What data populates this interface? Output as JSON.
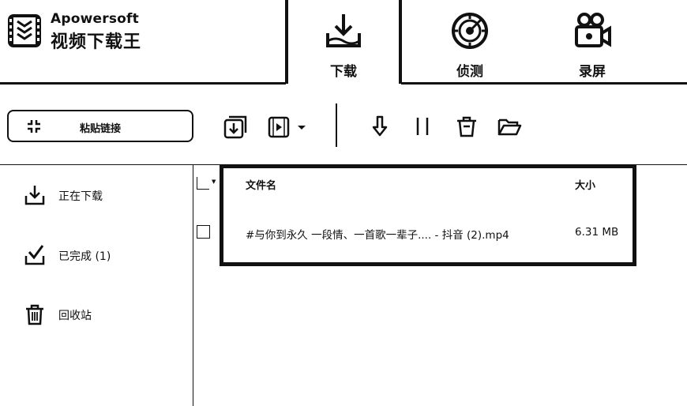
{
  "brand": {
    "name_en": "Apowersoft",
    "name_cn": "视频下载王",
    "logo_icon": "film-strip-logo-icon"
  },
  "tabs": [
    {
      "label": "下载",
      "icon": "download-tray-icon",
      "active": true
    },
    {
      "label": "侦测",
      "icon": "radar-target-icon",
      "active": false
    },
    {
      "label": "录屏",
      "icon": "video-camera-icon",
      "active": false
    }
  ],
  "toolbar": {
    "paste_label": "粘贴链接",
    "paste_icon": "link-paste-icon",
    "tools": [
      {
        "name": "import-download-icon"
      },
      {
        "name": "video-menu-icon"
      },
      {
        "name": "start-download-icon"
      },
      {
        "name": "pause-icon"
      },
      {
        "name": "delete-icon"
      },
      {
        "name": "open-folder-icon"
      }
    ]
  },
  "sidebar": {
    "items": [
      {
        "label": "正在下载",
        "icon": "download-icon"
      },
      {
        "label": "已完成 (1)",
        "icon": "check-tray-icon"
      },
      {
        "label": "回收站",
        "icon": "trash-icon"
      }
    ]
  },
  "file_list": {
    "columns": {
      "name": "文件名",
      "size": "大小"
    },
    "rows": [
      {
        "name": "#与你到永久 一段情、一首歌一辈子.... - 抖音 (2).mp4",
        "size": "6.31 MB"
      }
    ]
  },
  "colors": {
    "ink": "#111111",
    "background": "#ffffff"
  }
}
